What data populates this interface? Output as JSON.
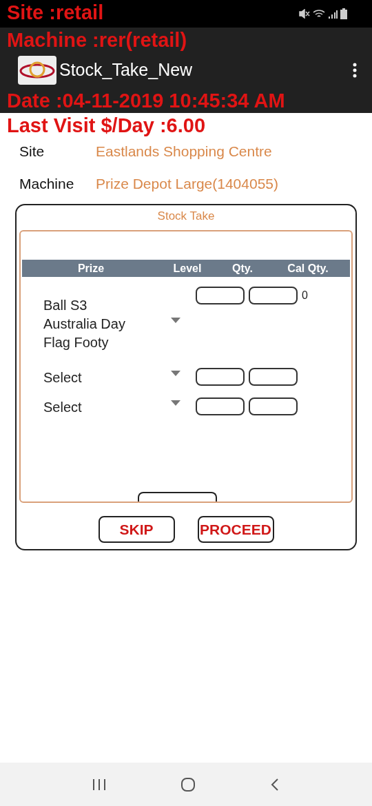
{
  "overlay": [
    "Site :retail",
    "Machine :rer(retail)",
    "Date :04-11-2019 10:45:34 AM",
    "Last Visit $/Day :6.00"
  ],
  "app_bar": {
    "title": "Stock_Take_New"
  },
  "info": [
    {
      "label": "Site",
      "value": "Eastlands Shopping Centre"
    },
    {
      "label": "Machine",
      "value": "Prize Depot Large(1404055)"
    }
  ],
  "card": {
    "title": "Stock Take",
    "columns": [
      "Prize",
      "Level",
      "Qty.",
      "Cal Qty."
    ],
    "rows": [
      {
        "prize": [
          "Ball S3",
          "Australia Day",
          "Flag Footy"
        ],
        "cal_qty": "0"
      },
      {
        "prize": [
          "Select"
        ]
      },
      {
        "prize": [
          "Select"
        ]
      }
    ],
    "buttons": [
      "SKIP",
      "PROCEED"
    ]
  }
}
